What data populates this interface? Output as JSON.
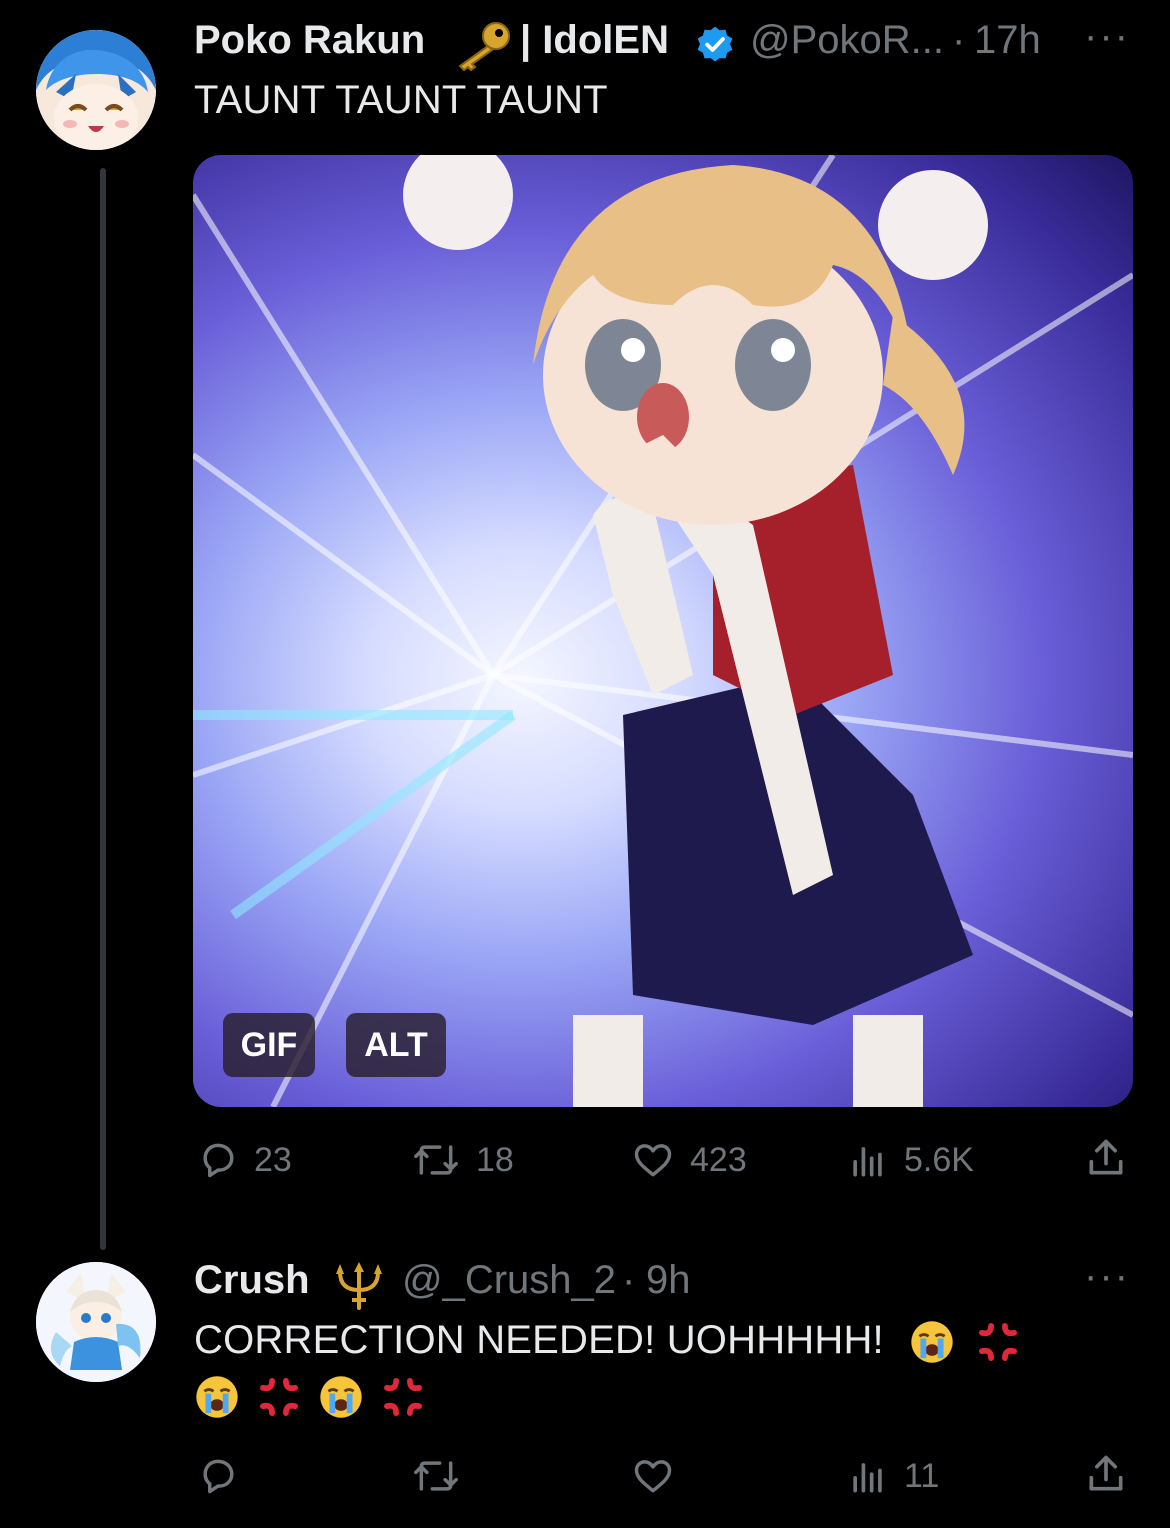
{
  "tweet": {
    "author_name": "Poko Rakun",
    "name_suffix": "| IdolEN",
    "handle": "@PokoR...",
    "dot": "·",
    "time": "17h",
    "more_label": "···",
    "text": "TAUNT TAUNT TAUNT",
    "media": {
      "gif_label": "GIF",
      "alt_label": "ALT"
    },
    "actions": {
      "replies": "23",
      "retweets": "18",
      "likes": "423",
      "views": "5.6K"
    }
  },
  "reply": {
    "author_name": "Crush",
    "handle": "@_Crush_2",
    "dot": "·",
    "time": "9h",
    "more_label": "···",
    "text_line1": "CORRECTION NEEDED! UOHHHHH!",
    "actions": {
      "views": "11"
    }
  },
  "colors": {
    "background": "#000000",
    "text_primary": "#e7e9ea",
    "text_secondary": "#71767b",
    "verified_blue": "#1d9bf0",
    "thread_line": "#333639"
  }
}
